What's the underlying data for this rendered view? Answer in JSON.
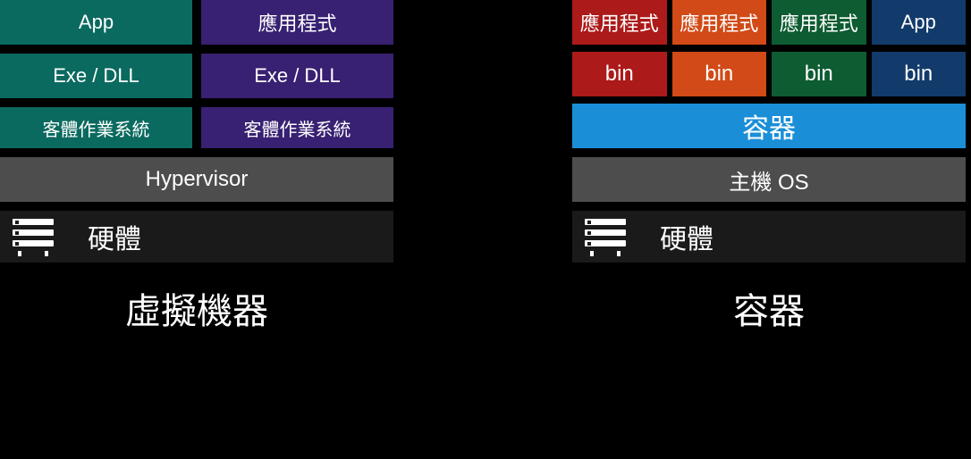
{
  "vm": {
    "title": "虛擬機器",
    "apps": [
      "App",
      "應用程式"
    ],
    "libs": [
      "Exe / DLL",
      "Exe / DLL"
    ],
    "guest_os": [
      "客體作業系統",
      "客體作業系統"
    ],
    "hypervisor": "Hypervisor",
    "hardware": "硬體"
  },
  "container": {
    "title": "容器",
    "apps": [
      "應用程式",
      "應用程式",
      "應用程式",
      "App"
    ],
    "bins": [
      "bin",
      "bin",
      "bin",
      "bin"
    ],
    "engine": "容器",
    "host_os": "主機 OS",
    "hardware": "硬體"
  }
}
